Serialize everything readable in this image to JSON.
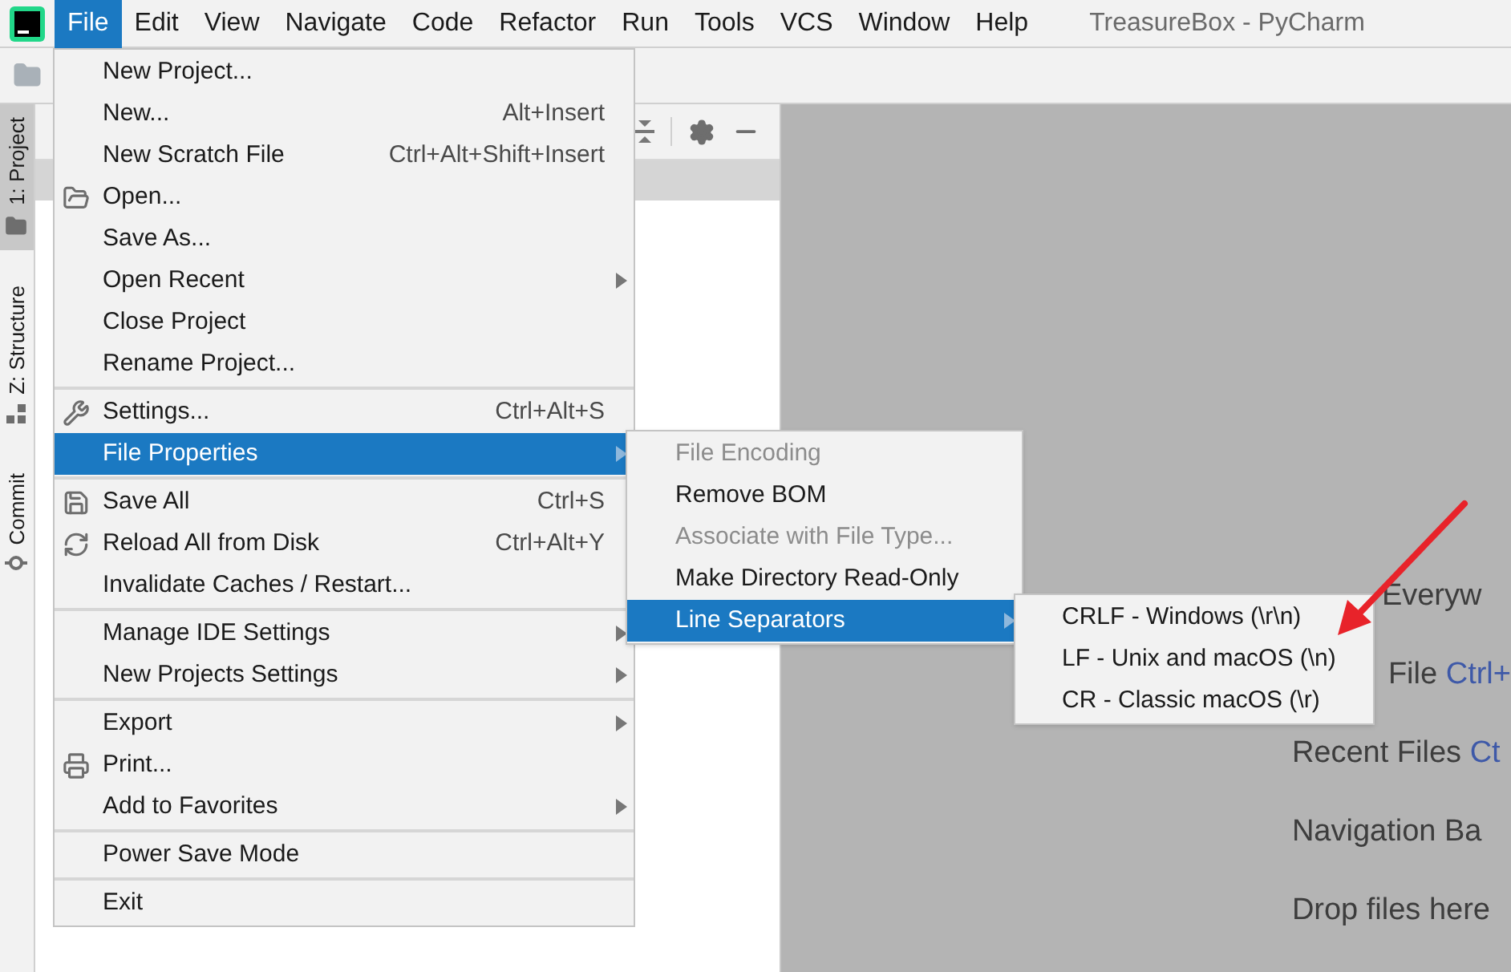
{
  "window": {
    "title": "TreasureBox - PyCharm"
  },
  "menubar": [
    {
      "label": "File",
      "selected": true
    },
    {
      "label": "Edit",
      "selected": false
    },
    {
      "label": "View",
      "selected": false
    },
    {
      "label": "Navigate",
      "selected": false
    },
    {
      "label": "Code",
      "selected": false
    },
    {
      "label": "Refactor",
      "selected": false
    },
    {
      "label": "Run",
      "selected": false
    },
    {
      "label": "Tools",
      "selected": false
    },
    {
      "label": "VCS",
      "selected": false
    },
    {
      "label": "Window",
      "selected": false
    },
    {
      "label": "Help",
      "selected": false
    }
  ],
  "tool_windows": [
    {
      "label": "1: Project",
      "selected": true
    },
    {
      "label": "Z: Structure",
      "selected": false
    },
    {
      "label": "Commit",
      "selected": false
    }
  ],
  "editor_hints": [
    {
      "label": "Everyw"
    },
    {
      "label": "File",
      "shortcut": "Ctrl+"
    },
    {
      "label": "Recent Files",
      "shortcut": "Ct"
    },
    {
      "label": "Navigation Ba"
    },
    {
      "label": "Drop files here"
    }
  ],
  "file_menu": [
    {
      "kind": "item",
      "label": "New Project...",
      "submenu": false,
      "selected": false
    },
    {
      "kind": "item",
      "label": "New...",
      "shortcut": "Alt+Insert",
      "submenu": false,
      "selected": false
    },
    {
      "kind": "item",
      "label": "New Scratch File",
      "shortcut": "Ctrl+Alt+Shift+Insert",
      "submenu": false,
      "selected": false
    },
    {
      "kind": "item",
      "label": "Open...",
      "submenu": false,
      "selected": false
    },
    {
      "kind": "item",
      "label": "Save As...",
      "submenu": false,
      "selected": false
    },
    {
      "kind": "item",
      "label": "Open Recent",
      "submenu": true,
      "selected": false
    },
    {
      "kind": "item",
      "label": "Close Project",
      "submenu": false,
      "selected": false
    },
    {
      "kind": "item",
      "label": "Rename Project...",
      "submenu": false,
      "selected": false
    },
    {
      "kind": "separator"
    },
    {
      "kind": "item",
      "label": "Settings...",
      "shortcut": "Ctrl+Alt+S",
      "submenu": false,
      "selected": false
    },
    {
      "kind": "item",
      "label": "File Properties",
      "submenu": true,
      "selected": true
    },
    {
      "kind": "separator"
    },
    {
      "kind": "item",
      "label": "Save All",
      "shortcut": "Ctrl+S",
      "submenu": false,
      "selected": false
    },
    {
      "kind": "item",
      "label": "Reload All from Disk",
      "shortcut": "Ctrl+Alt+Y",
      "submenu": false,
      "selected": false
    },
    {
      "kind": "item",
      "label": "Invalidate Caches / Restart...",
      "submenu": false,
      "selected": false
    },
    {
      "kind": "separator"
    },
    {
      "kind": "item",
      "label": "Manage IDE Settings",
      "submenu": true,
      "selected": false
    },
    {
      "kind": "item",
      "label": "New Projects Settings",
      "submenu": true,
      "selected": false
    },
    {
      "kind": "separator"
    },
    {
      "kind": "item",
      "label": "Export",
      "submenu": true,
      "selected": false
    },
    {
      "kind": "item",
      "label": "Print...",
      "submenu": false,
      "selected": false
    },
    {
      "kind": "item",
      "label": "Add to Favorites",
      "submenu": true,
      "selected": false
    },
    {
      "kind": "separator"
    },
    {
      "kind": "item",
      "label": "Power Save Mode",
      "submenu": false,
      "selected": false
    },
    {
      "kind": "separator"
    },
    {
      "kind": "item",
      "label": "Exit",
      "submenu": false,
      "selected": false
    }
  ],
  "file_properties_menu": [
    {
      "kind": "item",
      "label": "File Encoding",
      "disabled": true,
      "submenu": false,
      "selected": false
    },
    {
      "kind": "item",
      "label": "Remove BOM",
      "disabled": false,
      "submenu": false,
      "selected": false
    },
    {
      "kind": "item",
      "label": "Associate with File Type...",
      "disabled": true,
      "submenu": false,
      "selected": false
    },
    {
      "kind": "item",
      "label": "Make Directory Read-Only",
      "disabled": false,
      "submenu": false,
      "selected": false
    },
    {
      "kind": "item",
      "label": "Line Separators",
      "submenu": true,
      "disabled": false,
      "selected": true
    }
  ],
  "line_separators_menu": [
    {
      "kind": "item",
      "label": "CRLF - Windows (\\r\\n)",
      "submenu": false,
      "selected": false
    },
    {
      "kind": "item",
      "label": "LF - Unix and macOS (\\n)",
      "submenu": false,
      "selected": false
    },
    {
      "kind": "item",
      "label": "CR - Classic macOS (\\r)",
      "submenu": false,
      "selected": false
    }
  ]
}
